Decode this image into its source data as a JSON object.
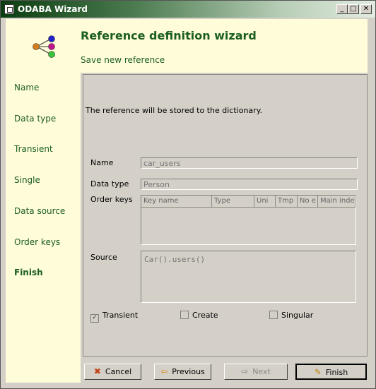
{
  "window": {
    "title": "ODABA Wizard"
  },
  "sidebar": {
    "steps": [
      "Name",
      "Data type",
      "Transient",
      "Single",
      "Data source",
      "Order keys",
      "Finish"
    ]
  },
  "header": {
    "title": "Reference definition wizard",
    "subtitle": "Save new reference"
  },
  "panel": {
    "note": "The reference will be stored to the dictionary.",
    "name_label": "Name",
    "name_value": "car_users",
    "datatype_label": "Data type",
    "datatype_value": "Person",
    "orderkeys_label": "Order keys",
    "orderkeys_columns": [
      "Key name",
      "Type",
      "Uni",
      "Tmp",
      "No e",
      "Main inde:"
    ],
    "source_label": "Source",
    "source_value": "Car().users()",
    "checkboxes": [
      {
        "label": "Transient",
        "checked": true
      },
      {
        "label": "Create",
        "checked": false
      },
      {
        "label": "Singular",
        "checked": false
      }
    ]
  },
  "buttons": {
    "cancel": "Cancel",
    "previous": "Previous",
    "next": "Next",
    "finish": "Finish"
  },
  "icons": {
    "steps": "graph-nodes-icon",
    "cancel": "cancel-x-icon",
    "previous": "arrow-left-icon",
    "next": "arrow-right-icon",
    "finish": "checkmark-icon"
  }
}
